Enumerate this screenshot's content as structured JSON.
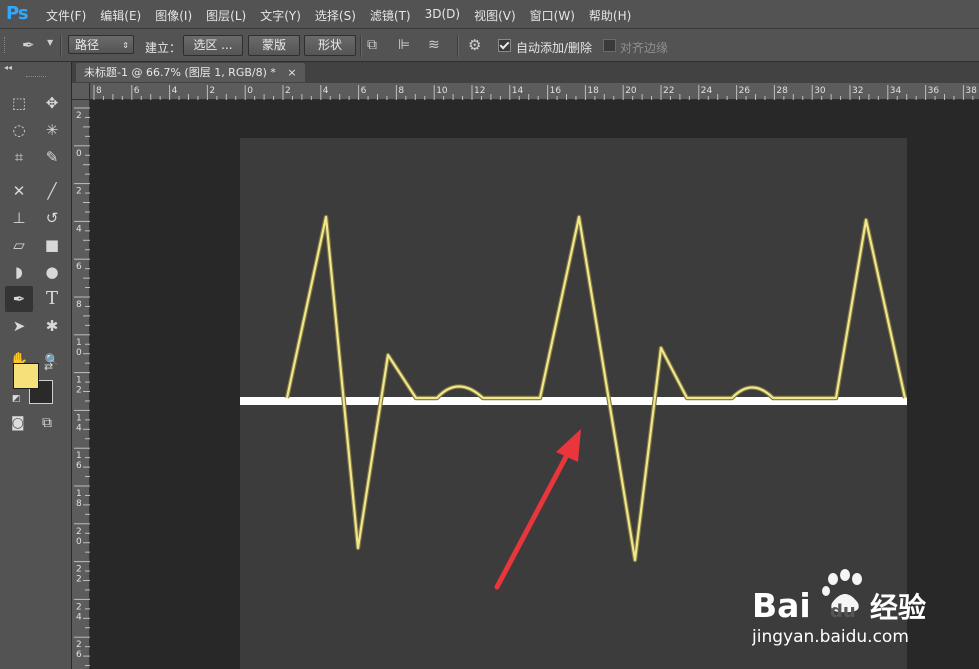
{
  "app": {
    "logo": "Ps",
    "menus": [
      "文件(F)",
      "编辑(E)",
      "图像(I)",
      "图层(L)",
      "文字(Y)",
      "选择(S)",
      "滤镜(T)",
      "3D(D)",
      "视图(V)",
      "窗口(W)",
      "帮助(H)"
    ]
  },
  "options": {
    "tool_mode": "路径",
    "build_label": "建立：",
    "selection_btn": "选区 ...",
    "mask_btn": "蒙版",
    "shape_btn": "形状",
    "auto_add_delete": {
      "label": "自动添加/删除",
      "checked": true
    },
    "align_edges": {
      "label": "对齐边缘",
      "checked": false
    }
  },
  "document": {
    "tab_title": "未标题-1 @ 66.7% (图层 1, RGB/8) *",
    "close_glyph": "×"
  },
  "rulers": {
    "h_labels": [
      "8",
      "6",
      "4",
      "2",
      "0",
      "2",
      "4",
      "6",
      "8",
      "10",
      "12",
      "14",
      "16",
      "18",
      "20",
      "22",
      "24",
      "26",
      "28",
      "30",
      "32",
      "34",
      "36",
      "38"
    ],
    "v_labels": [
      "2",
      "0",
      "2",
      "4",
      "6",
      "8",
      "1 0",
      "1 2",
      "1 4",
      "1 6",
      "1 8",
      "2 0",
      "2 2",
      "2 4",
      "2 6"
    ]
  },
  "colors": {
    "foreground": "#f5e07a",
    "background": "#2a2a2a",
    "path_stroke": "#f0e68c",
    "annotation_arrow": "#e8363c",
    "canvas": "#3d3c3d",
    "baseline": "#ffffff"
  },
  "tools": [
    [
      "marquee-icon",
      "move-icon"
    ],
    [
      "lasso-icon",
      "magic-wand-icon"
    ],
    [
      "crop-icon",
      "eyedropper-icon"
    ],
    [
      "healing-icon",
      "brush-icon"
    ],
    [
      "stamp-icon",
      "history-brush-icon"
    ],
    [
      "eraser-icon",
      "gradient-icon"
    ],
    [
      "blur-icon",
      "dodge-icon"
    ],
    [
      "pen-icon",
      "type-icon"
    ],
    [
      "path-select-icon",
      "custom-shape-icon"
    ],
    [
      "hand-icon",
      "zoom-icon"
    ]
  ],
  "tool_glyphs": {
    "marquee-icon": "⬚",
    "move-icon": "✥",
    "lasso-icon": "◌",
    "magic-wand-icon": "✳",
    "crop-icon": "⌗",
    "eyedropper-icon": "✎",
    "healing-icon": "✕",
    "brush-icon": "╱",
    "stamp-icon": "⊥",
    "history-brush-icon": "↺",
    "eraser-icon": "▱",
    "gradient-icon": "■",
    "blur-icon": "◗",
    "dodge-icon": "●",
    "pen-icon": "✒",
    "type-icon": "T",
    "path-select-icon": "➤",
    "custom-shape-icon": "✱",
    "hand-icon": "✋",
    "zoom-icon": "🔍"
  },
  "watermark": {
    "brand": "Bai",
    "brand2": "du",
    "suffix": "经验",
    "url": "jingyan.baidu.com"
  }
}
